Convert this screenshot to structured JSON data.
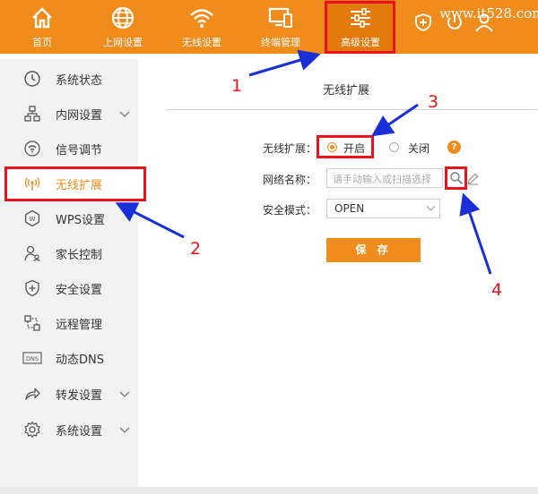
{
  "watermark": "www.it528.com",
  "topnav": {
    "tabs": [
      {
        "label": "首页",
        "icon": "home-icon"
      },
      {
        "label": "上网设置",
        "icon": "globe-icon"
      },
      {
        "label": "无线设置",
        "icon": "wifi-icon"
      },
      {
        "label": "终端管理",
        "icon": "devices-icon"
      },
      {
        "label": "高级设置",
        "icon": "sliders-icon",
        "active": true
      }
    ],
    "utility_icons": [
      "plus-shield-icon",
      "power-icon",
      "user-icon"
    ]
  },
  "sidebar": {
    "items": [
      {
        "label": "系统状态",
        "icon": "clock-icon"
      },
      {
        "label": "内网设置",
        "icon": "network-icon",
        "expandable": true
      },
      {
        "label": "信号调节",
        "icon": "signal-icon"
      },
      {
        "label": "无线扩展",
        "icon": "antenna-icon",
        "active": true
      },
      {
        "label": "WPS设置",
        "icon": "wps-icon"
      },
      {
        "label": "家长控制",
        "icon": "parent-icon"
      },
      {
        "label": "安全设置",
        "icon": "shield-icon"
      },
      {
        "label": "远程管理",
        "icon": "remote-icon"
      },
      {
        "label": "动态DNS",
        "icon": "dns-icon"
      },
      {
        "label": "转发设置",
        "icon": "forward-icon",
        "expandable": true
      },
      {
        "label": "系统设置",
        "icon": "gear-icon",
        "expandable": true
      }
    ]
  },
  "main": {
    "title": "无线扩展",
    "wireless_extend": {
      "label": "无线扩展：",
      "option_on": "开启",
      "option_off": "关闭",
      "selected": "开启",
      "help": "?"
    },
    "network_name": {
      "label": "网络名称：",
      "value": "",
      "placeholder": "请手动输入或扫描选择"
    },
    "security_mode": {
      "label": "安全模式：",
      "value": "OPEN"
    },
    "save_label": "保 存"
  },
  "annotations": [
    "1",
    "2",
    "3",
    "4"
  ],
  "colors": {
    "brand_orange": "#f08c1c",
    "annotation_red": "#e8141b",
    "annotation_blue": "#1b2fd6"
  }
}
